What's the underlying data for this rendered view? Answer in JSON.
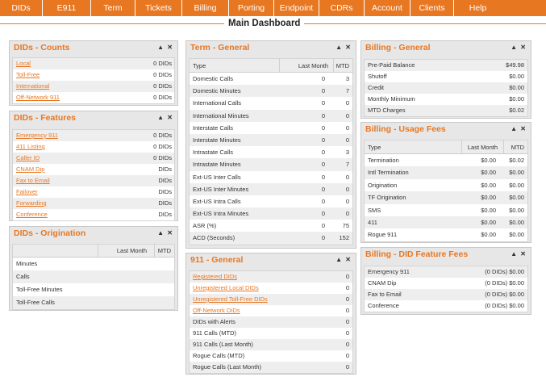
{
  "nav": [
    "DIDs",
    "E911",
    "Term",
    "Tickets",
    "Billing",
    "Porting",
    "Endpoint",
    "CDRs",
    "Account",
    "Clients",
    "Help"
  ],
  "page_title": "Main Dashboard",
  "controls": {
    "collapse": "▲",
    "close": "✕"
  },
  "panels": {
    "dids_counts": {
      "title": "DIDs - Counts",
      "rows": [
        {
          "label": "Local",
          "value": "0 DIDs"
        },
        {
          "label": "Toll-Free",
          "value": "0 DIDs"
        },
        {
          "label": "International",
          "value": "0 DIDs"
        },
        {
          "label": "Off-Network 911",
          "value": "0 DIDs"
        }
      ]
    },
    "dids_features": {
      "title": "DIDs - Features",
      "rows": [
        {
          "label": "Emergency 911",
          "value": "0 DIDs"
        },
        {
          "label": "411 Listing",
          "value": "0 DIDs"
        },
        {
          "label": "Caller ID",
          "value": "0 DIDs"
        },
        {
          "label": "CNAM Dip",
          "value": "DIDs"
        },
        {
          "label": "Fax to Email",
          "value": "DIDs"
        },
        {
          "label": "Failover",
          "value": "DIDs"
        },
        {
          "label": "Forwarding",
          "value": "DIDs"
        },
        {
          "label": "Conference",
          "value": "DIDs"
        }
      ]
    },
    "dids_origination": {
      "title": "DIDs - Origination",
      "columns": [
        "",
        "Last Month",
        "MTD"
      ],
      "rows": [
        {
          "label": "Minutes"
        },
        {
          "label": "Calls"
        },
        {
          "label": "Toll-Free Minutes"
        },
        {
          "label": "Toll-Free Calls"
        }
      ]
    },
    "term_general": {
      "title": "Term - General",
      "columns": [
        "Type",
        "Last Month",
        "MTD"
      ],
      "rows": [
        {
          "label": "Domestic Calls",
          "last": "0",
          "mtd": "3"
        },
        {
          "label": "Domestic Minutes",
          "last": "0",
          "mtd": "7"
        },
        {
          "label": "International Calls",
          "last": "0",
          "mtd": "0"
        },
        {
          "label": "International Minutes",
          "last": "0",
          "mtd": "0"
        },
        {
          "label": "Interstate Calls",
          "last": "0",
          "mtd": "0"
        },
        {
          "label": "Interstate Minutes",
          "last": "0",
          "mtd": "0"
        },
        {
          "label": "Intrastate Calls",
          "last": "0",
          "mtd": "3"
        },
        {
          "label": "Intrastate Minutes",
          "last": "0",
          "mtd": "7"
        },
        {
          "label": "Ext-US Inter Calls",
          "last": "0",
          "mtd": "0"
        },
        {
          "label": "Ext-US Inter Minutes",
          "last": "0",
          "mtd": "0"
        },
        {
          "label": "Ext-US Intra Calls",
          "last": "0",
          "mtd": "0"
        },
        {
          "label": "Ext-US Intra Minutes",
          "last": "0",
          "mtd": "0"
        },
        {
          "label": "ASR (%)",
          "last": "0",
          "mtd": "75"
        },
        {
          "label": "ACD (Seconds)",
          "last": "0",
          "mtd": "152"
        }
      ]
    },
    "e911_general": {
      "title": "911 - General",
      "rows": [
        {
          "label": "Registered DIDs",
          "value": "0",
          "link": true
        },
        {
          "label": "Unregistered Local DIDs",
          "value": "0",
          "link": true
        },
        {
          "label": "Unregistered Toll-Free DIDs",
          "value": "0",
          "link": true
        },
        {
          "label": "Off-Network DIDs",
          "value": "0",
          "link": true
        },
        {
          "label": "DIDs with Alerts",
          "value": "0",
          "link": false
        },
        {
          "label": "911 Calls (MTD)",
          "value": "0",
          "link": false
        },
        {
          "label": "911 Calls (Last Month)",
          "value": "0",
          "link": false
        },
        {
          "label": "Rogue Calls (MTD)",
          "value": "0",
          "link": false
        },
        {
          "label": "Rogue Calls (Last Month)",
          "value": "0",
          "link": false
        }
      ]
    },
    "billing_general": {
      "title": "Billing - General",
      "rows": [
        {
          "label": "Pre-Paid Balance",
          "value": "$49.98"
        },
        {
          "label": "Shutoff",
          "value": "$0.00"
        },
        {
          "label": "Credit",
          "value": "$0.00"
        },
        {
          "label": "Monthly Minimum",
          "value": "$0.00"
        },
        {
          "label": "MTD Charges",
          "value": "$0.02"
        }
      ]
    },
    "billing_usage": {
      "title": "Billing - Usage Fees",
      "columns": [
        "Type",
        "Last Month",
        "MTD"
      ],
      "rows": [
        {
          "label": "Termination",
          "last": "$0.00",
          "mtd": "$0.02"
        },
        {
          "label": "Intl Termination",
          "last": "$0.00",
          "mtd": "$0.00"
        },
        {
          "label": "Origination",
          "last": "$0.00",
          "mtd": "$0.00"
        },
        {
          "label": "TF Origination",
          "last": "$0.00",
          "mtd": "$0.00"
        },
        {
          "label": "SMS",
          "last": "$0.00",
          "mtd": "$0.00"
        },
        {
          "label": "411",
          "last": "$0.00",
          "mtd": "$0.00"
        },
        {
          "label": "Rogue 911",
          "last": "$0.00",
          "mtd": "$0.00"
        }
      ]
    },
    "billing_did_fees": {
      "title": "Billing - DID Feature Fees",
      "rows": [
        {
          "label": "Emergency 911",
          "value": "(0 DIDs) $0.00"
        },
        {
          "label": "CNAM Dip",
          "value": "(0 DIDs) $0.00"
        },
        {
          "label": "Fax to Email",
          "value": "(0 DIDs) $0.00"
        },
        {
          "label": "Conference",
          "value": "(0 DIDs) $0.00"
        }
      ]
    }
  },
  "colors": {
    "accent": "#e87722",
    "panel_bg": "#e7e7e7",
    "row_alt": "#eeeeee"
  }
}
